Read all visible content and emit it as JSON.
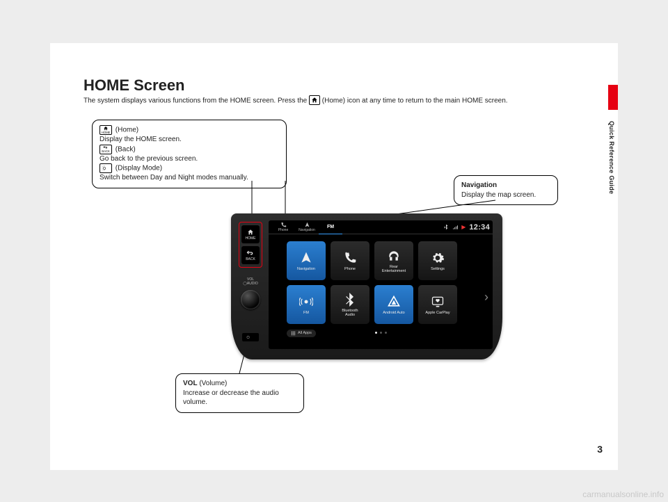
{
  "side_title": "Quick Reference Guide",
  "page_number": "3",
  "heading": "HOME Screen",
  "subhead_before": "The system displays various functions from the HOME screen. Press the ",
  "subhead_after": " (Home) icon at any time to return to the main HOME screen.",
  "callouts": {
    "buttons": {
      "home_label": " (Home)",
      "home_desc": "Display the HOME screen.",
      "back_label": " (Back)",
      "back_desc": "Go back to the previous screen.",
      "mode_label": " (Display Mode)",
      "mode_desc": "Switch between Day and Night modes manually."
    },
    "nav": {
      "title": "Navigation",
      "desc": "Display the map screen."
    },
    "vol": {
      "title": "VOL",
      "title_suffix": " (Volume)",
      "desc": "Increase or decrease the audio volume."
    }
  },
  "unit": {
    "phys": {
      "home": "HOME",
      "back": "BACK",
      "vol": "VOL",
      "audio": "AUDIO"
    },
    "tabs": {
      "phone": "Phone",
      "navigation": "Navigation",
      "fm": "FM"
    },
    "clock": "12:34",
    "apps": {
      "navigation": "Navigation",
      "phone": "Phone",
      "rear": "Rear\nEntertainment",
      "settings": "Settings",
      "fm": "FM",
      "bt": "Bluetooth\nAudio",
      "aa": "Android Auto",
      "cp": "Apple CarPlay"
    },
    "allapps": "All Apps"
  },
  "watermark": "carmanualsonline.info"
}
